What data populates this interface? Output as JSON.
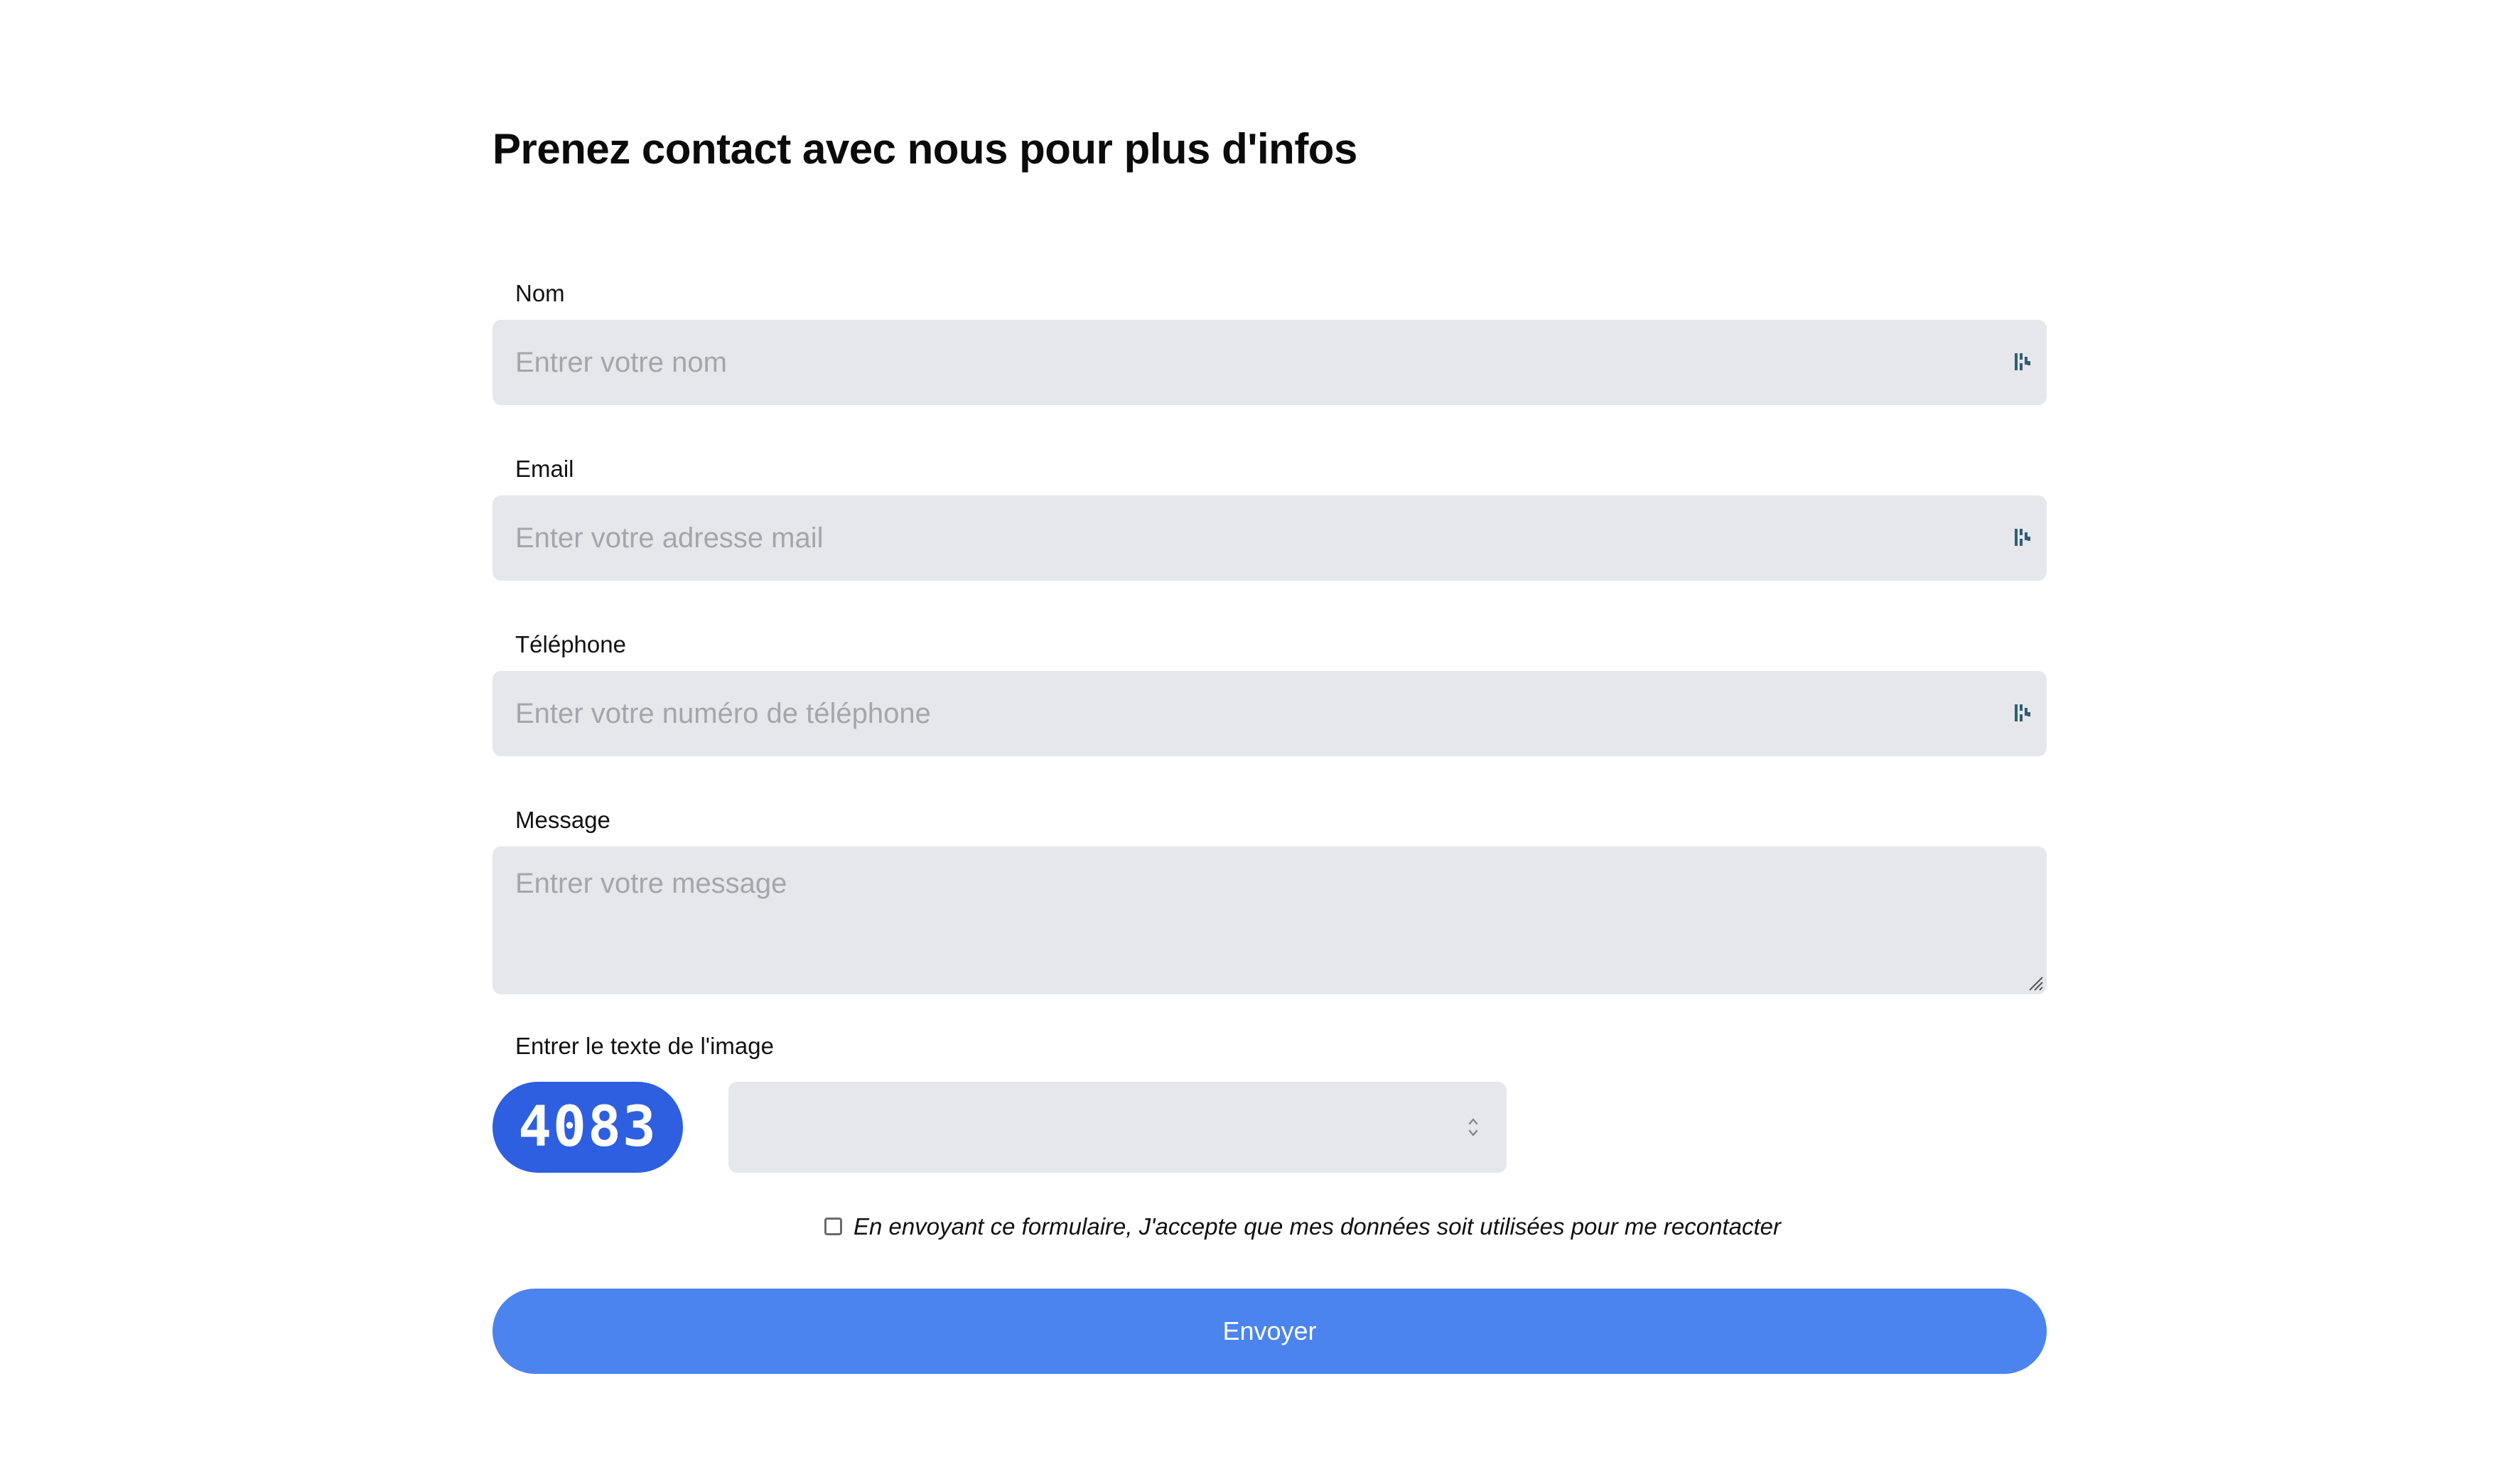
{
  "page": {
    "title": "Prenez contact avec nous pour plus d'infos"
  },
  "form": {
    "name": {
      "label": "Nom",
      "placeholder": "Entrer votre nom",
      "value": ""
    },
    "email": {
      "label": "Email",
      "placeholder": "Enter votre adresse mail",
      "value": ""
    },
    "phone": {
      "label": "Téléphone",
      "placeholder": "Enter votre numéro de téléphone",
      "value": ""
    },
    "message": {
      "label": "Message",
      "placeholder": "Entrer votre message",
      "value": ""
    },
    "captcha": {
      "label": "Entrer le texte de l'image",
      "image_text": "4083",
      "value": ""
    },
    "consent": {
      "text": "En envoyant ce formulaire, J'accepte que mes données soit utilisées pour me recontacter",
      "checked": false
    },
    "submit_label": "Envoyer"
  },
  "icons": {
    "field_icon": "keyboard-autofill-icon",
    "resize": "resize-grip-icon",
    "number_spinner": "spinner-arrows-icon",
    "checkbox": "checkbox-icon"
  },
  "colors": {
    "field_background": "#e5e7eb",
    "primary_button": "#4b84ee",
    "captcha_background": "#2d5fe0",
    "placeholder_text": "#a2a6ad",
    "icon_color": "#2f5d7a"
  }
}
